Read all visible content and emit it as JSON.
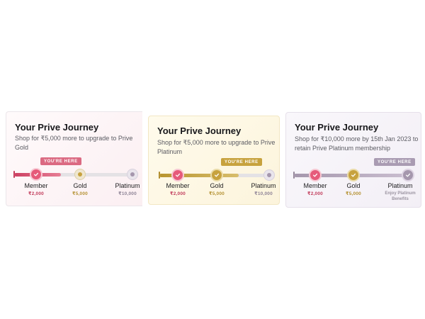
{
  "cards": [
    {
      "title": "Your Prive Journey",
      "subtitle": "Shop for ₹5,000 more to upgrade to Prive Gold",
      "badge": "YOU'RE HERE",
      "progress_fraction": 0.5,
      "tiers": [
        {
          "name": "Member",
          "price": "₹2,000"
        },
        {
          "name": "Gold",
          "price": "₹5,000"
        },
        {
          "name": "Platinum",
          "price": "₹10,000"
        }
      ]
    },
    {
      "title": "Your Prive Journey",
      "subtitle": "Shop for ₹5,000 more to upgrade to Prive Platinum",
      "badge": "YOU'RE HERE",
      "progress_fraction": 0.75,
      "tiers": [
        {
          "name": "Member",
          "price": "₹2,000"
        },
        {
          "name": "Gold",
          "price": "₹5,000"
        },
        {
          "name": "Platinum",
          "price": "₹10,000"
        }
      ]
    },
    {
      "title": "Your Prive Journey",
      "subtitle": "Shop for ₹10,000 more by 15th Jan 2023 to retain Prive Platinum membership",
      "badge": "YOU'RE HERE",
      "progress_fraction": 1.0,
      "tiers": [
        {
          "name": "Member",
          "price": "₹2,000"
        },
        {
          "name": "Gold",
          "price": "₹5,000"
        },
        {
          "name": "Platinum",
          "note": "Enjoy Platinum Benefits"
        }
      ]
    }
  ],
  "colors": {
    "member": "#d94a6a",
    "gold": "#c7a23e",
    "platinum": "#a597ad",
    "inactive": "#c9c6cc"
  },
  "icons": {
    "completed": "check-icon",
    "pending": "dot-icon"
  }
}
